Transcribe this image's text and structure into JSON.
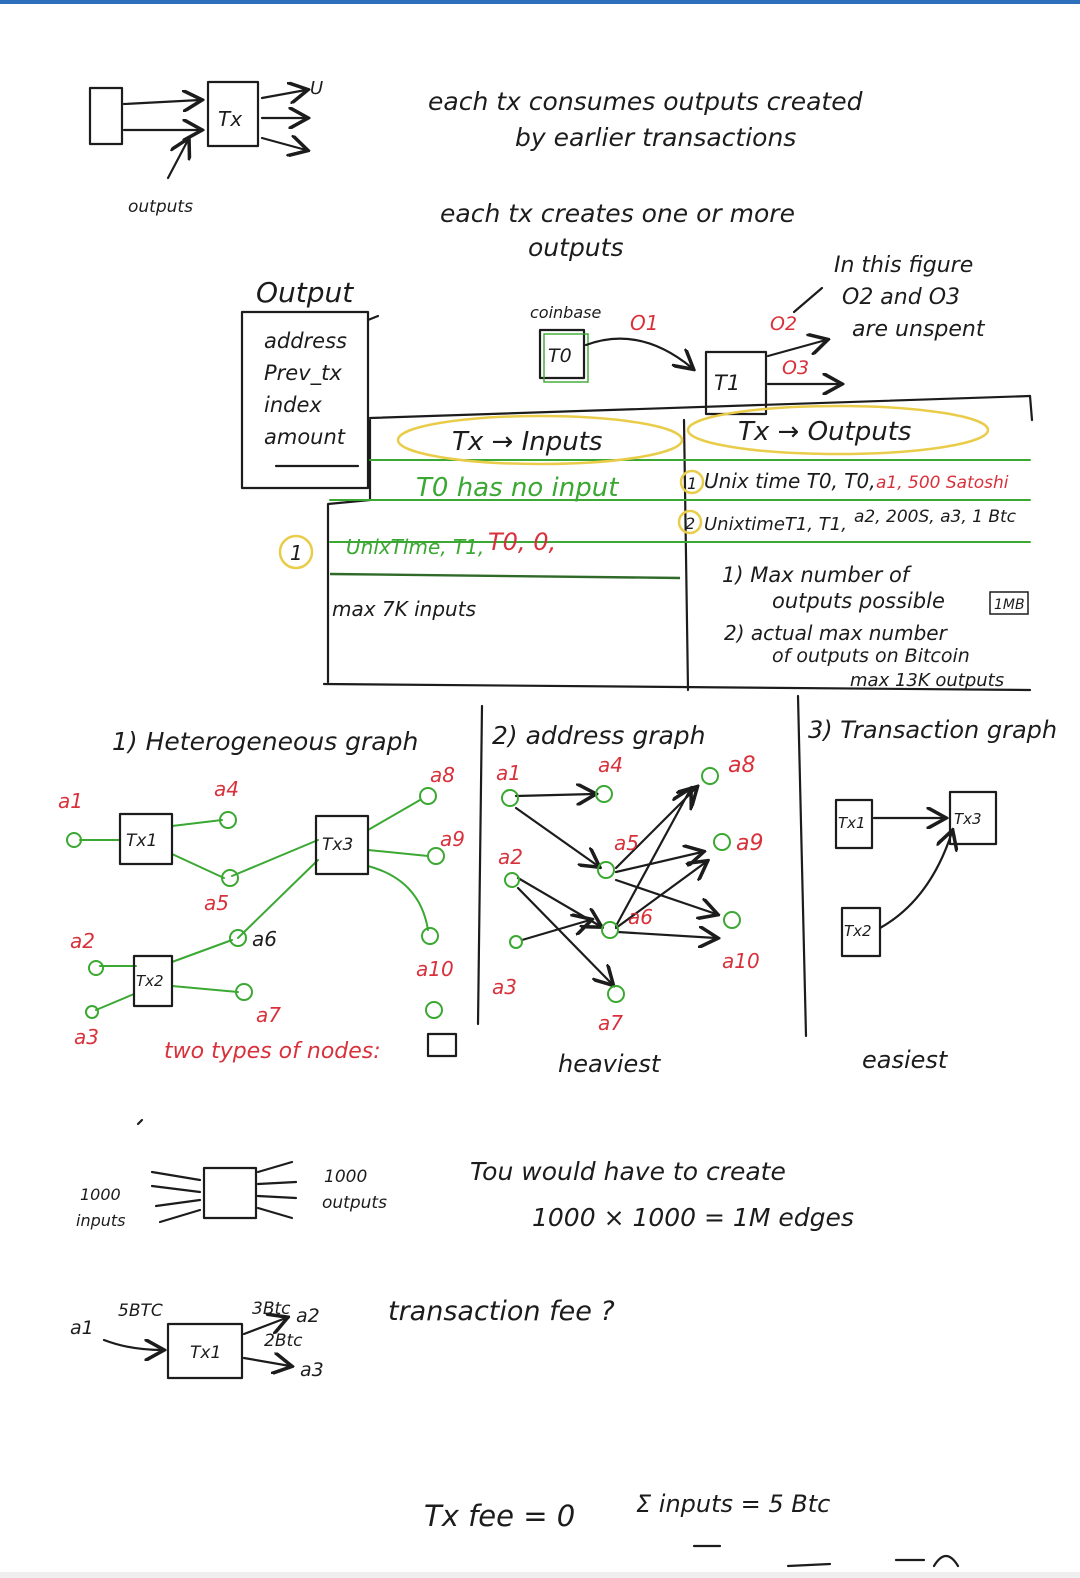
{
  "top": {
    "sketch_tx": "Tx",
    "sketch_u": "U",
    "outputs_label": "outputs",
    "note1_l1": "each tx consumes outputs created",
    "note1_l2": "by earlier transactions",
    "note2_l1": "each tx creates one or more",
    "note2_l2": "outputs"
  },
  "output_box": {
    "title": "Output",
    "fields": [
      "address",
      "Prev_tx",
      "index",
      "amount"
    ]
  },
  "chain": {
    "coinbase": "coinbase",
    "t0": "T0",
    "o1": "O1",
    "t1": "T1",
    "o2": "O2",
    "o3": "O3",
    "note_l1": "In this figure",
    "note_l2": "O2 and O3",
    "note_l3": "are unspent"
  },
  "table": {
    "inputs_header": "Tx → Inputs",
    "outputs_header": "Tx → Outputs",
    "no_input": "T0 has no input",
    "input_row_a": "UnixTime, T1,",
    "input_row_b": "T0, 0,",
    "input_num": "1",
    "max_inputs": "max 7K inputs",
    "out_num_1": "1",
    "out_row1_a": "Unix time T0, T0,",
    "out_row1_b": "a1, 500 Satoshi",
    "out_num_2": "2",
    "out_row2_a": "UnixtimeT1, T1,",
    "out_row2_b": "a2, 200S, a3, 1 Btc",
    "note1_l1": "1) Max number of",
    "note1_l2": "outputs possible",
    "note1_box": "1MB",
    "note2_l1": "2) actual max number",
    "note2_l2": "of outputs on Bitcoin",
    "note2_l3": "max 13K outputs"
  },
  "graphs": {
    "g1_title": "1) Heterogeneous graph",
    "g2_title": "2) address graph",
    "g3_title": "3) Transaction graph",
    "tx1": "Tx1",
    "tx2": "Tx2",
    "tx3": "Tx3",
    "a1": "a1",
    "a2": "a2",
    "a3": "a3",
    "a4": "a4",
    "a5": "a5",
    "a6": "a6",
    "a7": "a7",
    "a8": "a8",
    "a9": "a9",
    "a10": "a10",
    "two_types": "two types of nodes:",
    "heaviest": "heaviest",
    "easiest": "easiest"
  },
  "lower": {
    "inputs_l1": "1000",
    "inputs_l2": "inputs",
    "outputs_l1": "1000",
    "outputs_l2": "outputs",
    "edge_l1": "Tou would have to create",
    "edge_l2": "1000 × 1000 = 1M edges",
    "fee_a1": "a1",
    "fee_5btc": "5BTC",
    "fee_tx": "Tx1",
    "fee_3btc": "3Btc",
    "fee_a2": "a2",
    "fee_2btc": "2Btc",
    "fee_a3": "a3",
    "fee_question": "transaction fee ?",
    "fee_eq": "Tx fee = 0",
    "sigma_inputs": "Σ inputs = 5 Btc"
  },
  "colors": {
    "ink": "#1c1c1c",
    "red": "#d8313b",
    "green": "#3aa832",
    "yellow_highlight": "#e9cc4a",
    "topbar": "#2d6fba"
  }
}
